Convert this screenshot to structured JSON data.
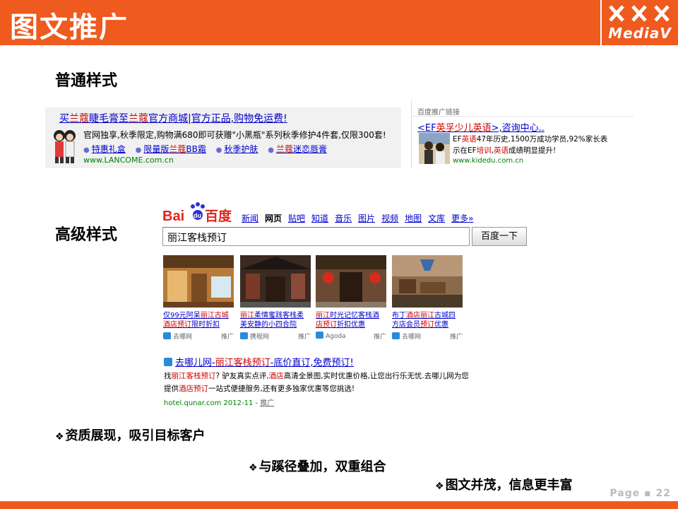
{
  "header": {
    "title": "图文推广",
    "logo_text": "MediaV",
    "colors": {
      "bar": "#ef5a1f"
    }
  },
  "sections": {
    "normal": "普通样式",
    "advanced": "高级样式"
  },
  "ad_normal_1": {
    "title_pre": "买",
    "title_hl1": "兰蔻",
    "title_mid": "睫毛膏至",
    "title_hl2": "兰蔻",
    "title_post": "官方商城|官方正品,购物免运费!",
    "desc": "官网独享,秋季限定,购物满680即可获赠\"小黑瓶\"系列秋季修护4件套,仅限300套!",
    "links": [
      {
        "pre": "特惠礼盒",
        "hl": "",
        "post": ""
      },
      {
        "pre": "限量版",
        "hl": "兰蔻",
        "post": "BB霜"
      },
      {
        "pre": "秋季护肤",
        "hl": "",
        "post": ""
      },
      {
        "pre": "",
        "hl": "兰蔻",
        "post": "迷恋唇膏"
      }
    ],
    "url": "www.LANCOME.com.cn"
  },
  "ad_normal_2": {
    "label": "百度推广链接",
    "title_pre": "<EF",
    "title_hl": "英孚少儿英语",
    "title_post": ">,咨询中心..",
    "desc1_pre": "EF",
    "desc1_hl": "英语",
    "desc1_post": "47年历史,1500万成功学员,92%家长表",
    "desc2_pre": "示在EF",
    "desc2_hl1": "培训",
    "desc2_mid": ",",
    "desc2_hl2": "英语",
    "desc2_post": "成绩明显提升!",
    "url": "www.kidedu.com.cn"
  },
  "baidu": {
    "logo_bai": "Bai",
    "logo_du": "du",
    "logo_cn": "百度",
    "nav": [
      "新闻",
      "网页",
      "贴吧",
      "知道",
      "音乐",
      "图片",
      "视频",
      "地图",
      "文库",
      "更多»"
    ],
    "nav_active": "网页",
    "query": "丽江客栈预订",
    "button": "百度一下"
  },
  "cards": [
    {
      "line1_pre": "仅99元阿呆",
      "line1_hl": "丽江古城",
      "line1_post": "",
      "line2_pre": "",
      "line2_hl": "酒店预订",
      "line2_post": "限时折扣",
      "source": "去哪网",
      "promo": "推广"
    },
    {
      "line1_pre": "",
      "line1_hl": "丽江",
      "line1_post": "柔情蜜践客栈柔",
      "line2_pre": "美安静的小四合院",
      "line2_hl": "",
      "line2_post": "",
      "source": "携程网",
      "promo": "推广"
    },
    {
      "line1_pre": "",
      "line1_hl": "丽江",
      "line1_post": "时光记忆客栈酒",
      "line2_pre": "",
      "line2_hl": "店预订",
      "line2_post": "折扣优惠",
      "source": "Agoda",
      "promo": "推广"
    },
    {
      "line1_pre": "布丁",
      "line1_hl": "酒店丽江",
      "line1_post": "古城四",
      "line2_pre": "方店会员",
      "line2_hl": "预订",
      "line2_post": "优惠",
      "source": "去哪网",
      "promo": "推广"
    }
  ],
  "qunar": {
    "title_pre": "去哪儿网-",
    "title_hl": "丽江客栈预订",
    "title_post": "-底价直订,免费预订!",
    "line1_pre": "找",
    "line1_hl1": "丽江客栈预订",
    "line1_mid": "? 驴友真实点评,",
    "line1_hl2": "酒店",
    "line1_post": "高清全景图,实时优惠价格,让您出行乐无忧.去哪儿网为您",
    "line2_pre": "提供",
    "line2_hl": "酒店预订",
    "line2_post": "一站式便捷服务,还有更多独家优惠等您挑选!",
    "url": "hotel.qunar.com 2012-11 - ",
    "promo": "推广"
  },
  "points": [
    "资质展现，吸引目标客户",
    "与蹊径叠加，双重组合",
    "图文并茂，信息更丰富"
  ],
  "page": "Page ▪ 22"
}
